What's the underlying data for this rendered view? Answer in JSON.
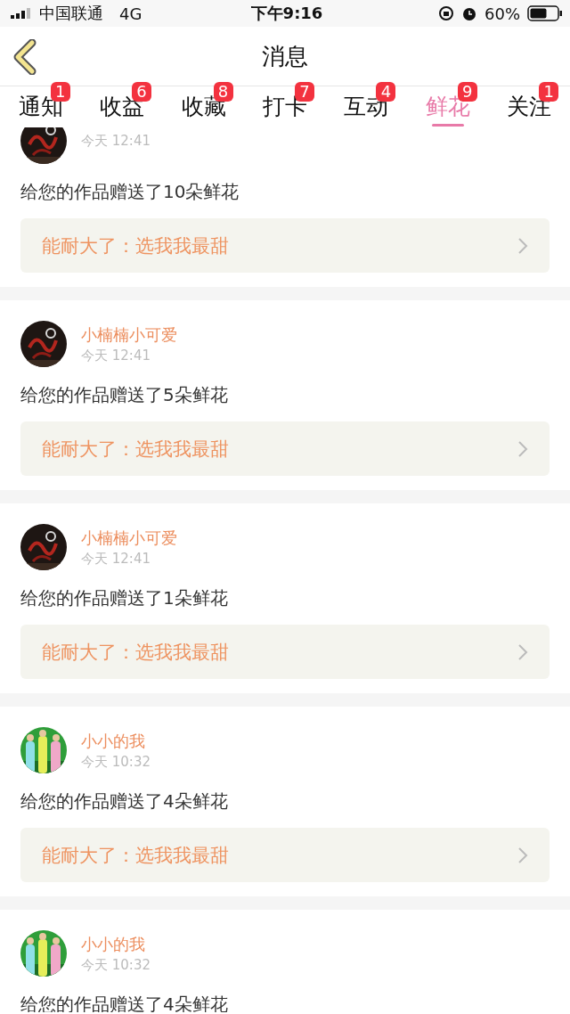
{
  "status_bar": {
    "carrier": "中国联通",
    "network": "4G",
    "time": "下午9:16",
    "battery": "60%"
  },
  "nav": {
    "title": "消息"
  },
  "tabs": [
    {
      "label": "通知",
      "badge": "1",
      "selected": false
    },
    {
      "label": "收益",
      "badge": "6",
      "selected": false
    },
    {
      "label": "收藏",
      "badge": "8",
      "selected": false
    },
    {
      "label": "打卡",
      "badge": "7",
      "selected": false
    },
    {
      "label": "互动",
      "badge": "4",
      "selected": false
    },
    {
      "label": "鲜花",
      "badge": "9",
      "selected": true
    },
    {
      "label": "关注",
      "badge": "1",
      "selected": false
    }
  ],
  "messages": [
    {
      "time": "今天 12:41",
      "text": "给您的作品赠送了10朵鲜花",
      "note": "能耐大了：选我我最甜"
    },
    {
      "name": "小楠楠小可爱",
      "time": "今天 12:41",
      "text": "给您的作品赠送了5朵鲜花",
      "note": "能耐大了：选我我最甜"
    },
    {
      "name": "小楠楠小可爱",
      "time": "今天 12:41",
      "text": "给您的作品赠送了1朵鲜花",
      "note": "能耐大了：选我我最甜"
    },
    {
      "name": "小小的我",
      "time": "今天 10:32",
      "text": "给您的作品赠送了4朵鲜花",
      "note": "能耐大了：选我我最甜"
    },
    {
      "name": "小小的我",
      "time": "今天 10:32",
      "text": "给您的作品赠送了4朵鲜花"
    }
  ]
}
